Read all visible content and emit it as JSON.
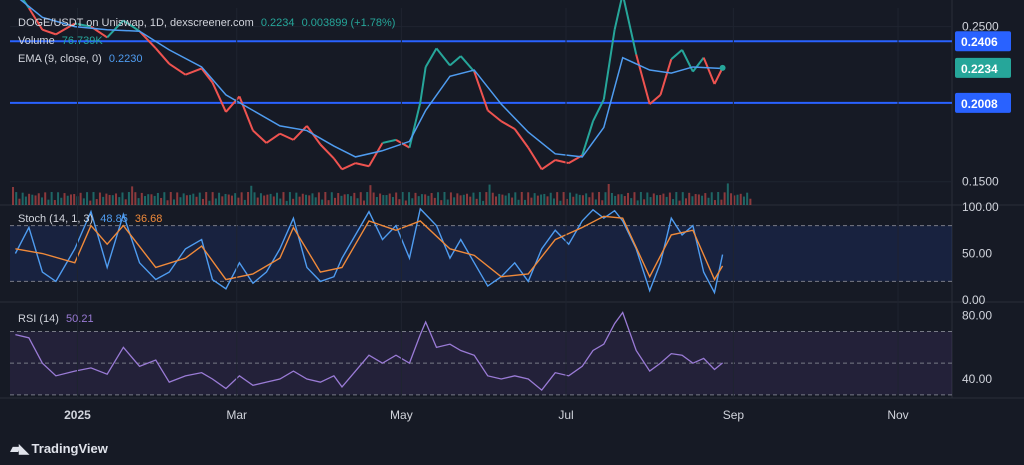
{
  "header": {
    "symbol": "DOGE/USDT on Uniswap, 1D, dexscreener.com",
    "last": "0.2234",
    "change": "0.003899 (+1.78%)",
    "volume_label": "Volume",
    "volume_value": "76.739K",
    "ema_label": "EMA (9, close, 0)",
    "ema_value": "0.2230"
  },
  "stoch": {
    "label": "Stoch (14, 1, 3)",
    "k": "48.85",
    "d": "36.68"
  },
  "rsi": {
    "label": "RSI (14)",
    "value": "50.21"
  },
  "brand": "TradingView",
  "colors": {
    "up": "#26a69a",
    "down": "#ef5350",
    "line": "#2962ff",
    "ema": "#4f9cf0",
    "stoch_k": "#4f9cf0",
    "stoch_d": "#f08a3a",
    "rsi": "#9a7bd6",
    "bg": "#161a25"
  },
  "chart_data": [
    {
      "type": "line",
      "panel": "price",
      "y_ticks": [
        "0.2500",
        "0.1500"
      ],
      "ylim": [
        0.135,
        0.262
      ],
      "horizontal_lines": [
        {
          "value": 0.2406,
          "label": "0.2406"
        },
        {
          "value": 0.2008,
          "label": "0.2008"
        }
      ],
      "last_price_label": "0.2234",
      "x_ticks": [
        "2025",
        "Mar",
        "May",
        "Jul",
        "Sep",
        "Nov"
      ],
      "xlim": [
        "2024-12-07",
        "2025-11-21"
      ],
      "close": [
        {
          "date": "2024-12-09",
          "v": 0.275
        },
        {
          "date": "2024-12-14",
          "v": 0.262
        },
        {
          "date": "2024-12-19",
          "v": 0.248
        },
        {
          "date": "2024-12-24",
          "v": 0.245
        },
        {
          "date": "2024-12-31",
          "v": 0.252
        },
        {
          "date": "2025-01-06",
          "v": 0.25
        },
        {
          "date": "2025-01-12",
          "v": 0.243
        },
        {
          "date": "2025-01-18",
          "v": 0.254
        },
        {
          "date": "2025-01-24",
          "v": 0.247
        },
        {
          "date": "2025-01-30",
          "v": 0.236
        },
        {
          "date": "2025-02-04",
          "v": 0.226
        },
        {
          "date": "2025-02-10",
          "v": 0.219
        },
        {
          "date": "2025-02-16",
          "v": 0.223
        },
        {
          "date": "2025-02-20",
          "v": 0.214
        },
        {
          "date": "2025-02-25",
          "v": 0.195
        },
        {
          "date": "2025-03-02",
          "v": 0.205
        },
        {
          "date": "2025-03-07",
          "v": 0.183
        },
        {
          "date": "2025-03-12",
          "v": 0.175
        },
        {
          "date": "2025-03-17",
          "v": 0.181
        },
        {
          "date": "2025-03-22",
          "v": 0.177
        },
        {
          "date": "2025-03-27",
          "v": 0.186
        },
        {
          "date": "2025-04-01",
          "v": 0.174
        },
        {
          "date": "2025-04-06",
          "v": 0.165
        },
        {
          "date": "2025-04-09",
          "v": 0.158
        },
        {
          "date": "2025-04-14",
          "v": 0.162
        },
        {
          "date": "2025-04-19",
          "v": 0.16
        },
        {
          "date": "2025-04-24",
          "v": 0.175
        },
        {
          "date": "2025-04-29",
          "v": 0.177
        },
        {
          "date": "2025-05-04",
          "v": 0.172
        },
        {
          "date": "2025-05-08",
          "v": 0.201
        },
        {
          "date": "2025-05-10",
          "v": 0.224
        },
        {
          "date": "2025-05-14",
          "v": 0.236
        },
        {
          "date": "2025-05-19",
          "v": 0.225
        },
        {
          "date": "2025-05-23",
          "v": 0.231
        },
        {
          "date": "2025-05-28",
          "v": 0.221
        },
        {
          "date": "2025-06-02",
          "v": 0.196
        },
        {
          "date": "2025-06-07",
          "v": 0.189
        },
        {
          "date": "2025-06-12",
          "v": 0.184
        },
        {
          "date": "2025-06-17",
          "v": 0.172
        },
        {
          "date": "2025-06-22",
          "v": 0.158
        },
        {
          "date": "2025-06-27",
          "v": 0.164
        },
        {
          "date": "2025-07-02",
          "v": 0.162
        },
        {
          "date": "2025-07-07",
          "v": 0.167
        },
        {
          "date": "2025-07-11",
          "v": 0.189
        },
        {
          "date": "2025-07-15",
          "v": 0.203
        },
        {
          "date": "2025-07-19",
          "v": 0.248
        },
        {
          "date": "2025-07-22",
          "v": 0.271
        },
        {
          "date": "2025-07-27",
          "v": 0.232
        },
        {
          "date": "2025-08-01",
          "v": 0.2
        },
        {
          "date": "2025-08-05",
          "v": 0.206
        },
        {
          "date": "2025-08-09",
          "v": 0.229
        },
        {
          "date": "2025-08-13",
          "v": 0.235
        },
        {
          "date": "2025-08-17",
          "v": 0.221
        },
        {
          "date": "2025-08-21",
          "v": 0.23
        },
        {
          "date": "2025-08-25",
          "v": 0.213
        },
        {
          "date": "2025-08-28",
          "v": 0.2234
        }
      ],
      "ema9": [
        {
          "date": "2024-12-09",
          "v": 0.27
        },
        {
          "date": "2024-12-19",
          "v": 0.256
        },
        {
          "date": "2024-12-31",
          "v": 0.25
        },
        {
          "date": "2025-01-12",
          "v": 0.248
        },
        {
          "date": "2025-01-24",
          "v": 0.247
        },
        {
          "date": "2025-02-04",
          "v": 0.235
        },
        {
          "date": "2025-02-16",
          "v": 0.224
        },
        {
          "date": "2025-02-25",
          "v": 0.206
        },
        {
          "date": "2025-03-07",
          "v": 0.196
        },
        {
          "date": "2025-03-17",
          "v": 0.186
        },
        {
          "date": "2025-03-27",
          "v": 0.183
        },
        {
          "date": "2025-04-06",
          "v": 0.173
        },
        {
          "date": "2025-04-14",
          "v": 0.166
        },
        {
          "date": "2025-04-24",
          "v": 0.17
        },
        {
          "date": "2025-05-04",
          "v": 0.176
        },
        {
          "date": "2025-05-10",
          "v": 0.196
        },
        {
          "date": "2025-05-19",
          "v": 0.218
        },
        {
          "date": "2025-05-28",
          "v": 0.222
        },
        {
          "date": "2025-06-07",
          "v": 0.2
        },
        {
          "date": "2025-06-17",
          "v": 0.182
        },
        {
          "date": "2025-06-27",
          "v": 0.168
        },
        {
          "date": "2025-07-07",
          "v": 0.166
        },
        {
          "date": "2025-07-15",
          "v": 0.185
        },
        {
          "date": "2025-07-22",
          "v": 0.23
        },
        {
          "date": "2025-08-01",
          "v": 0.222
        },
        {
          "date": "2025-08-09",
          "v": 0.22
        },
        {
          "date": "2025-08-17",
          "v": 0.224
        },
        {
          "date": "2025-08-28",
          "v": 0.223
        }
      ]
    },
    {
      "type": "line",
      "panel": "stochastic",
      "y_ticks": [
        "100.00",
        "50.00",
        "0.00"
      ],
      "ylim": [
        0,
        100
      ],
      "bands": [
        20,
        80
      ],
      "k": [
        {
          "date": "2024-12-09",
          "v": 50
        },
        {
          "date": "2024-12-14",
          "v": 78
        },
        {
          "date": "2024-12-19",
          "v": 30
        },
        {
          "date": "2024-12-24",
          "v": 20
        },
        {
          "date": "2024-12-31",
          "v": 55
        },
        {
          "date": "2025-01-06",
          "v": 95
        },
        {
          "date": "2025-01-12",
          "v": 35
        },
        {
          "date": "2025-01-18",
          "v": 92
        },
        {
          "date": "2025-01-24",
          "v": 40
        },
        {
          "date": "2025-01-30",
          "v": 22
        },
        {
          "date": "2025-02-04",
          "v": 30
        },
        {
          "date": "2025-02-10",
          "v": 55
        },
        {
          "date": "2025-02-16",
          "v": 65
        },
        {
          "date": "2025-02-20",
          "v": 22
        },
        {
          "date": "2025-02-25",
          "v": 12
        },
        {
          "date": "2025-03-02",
          "v": 40
        },
        {
          "date": "2025-03-07",
          "v": 18
        },
        {
          "date": "2025-03-12",
          "v": 30
        },
        {
          "date": "2025-03-17",
          "v": 55
        },
        {
          "date": "2025-03-22",
          "v": 88
        },
        {
          "date": "2025-03-27",
          "v": 35
        },
        {
          "date": "2025-04-01",
          "v": 20
        },
        {
          "date": "2025-04-06",
          "v": 25
        },
        {
          "date": "2025-04-09",
          "v": 45
        },
        {
          "date": "2025-04-14",
          "v": 70
        },
        {
          "date": "2025-04-19",
          "v": 95
        },
        {
          "date": "2025-04-24",
          "v": 65
        },
        {
          "date": "2025-04-29",
          "v": 80
        },
        {
          "date": "2025-05-04",
          "v": 45
        },
        {
          "date": "2025-05-08",
          "v": 98
        },
        {
          "date": "2025-05-14",
          "v": 80
        },
        {
          "date": "2025-05-19",
          "v": 45
        },
        {
          "date": "2025-05-23",
          "v": 65
        },
        {
          "date": "2025-05-28",
          "v": 40
        },
        {
          "date": "2025-06-02",
          "v": 15
        },
        {
          "date": "2025-06-07",
          "v": 25
        },
        {
          "date": "2025-06-12",
          "v": 40
        },
        {
          "date": "2025-06-17",
          "v": 20
        },
        {
          "date": "2025-06-22",
          "v": 55
        },
        {
          "date": "2025-06-27",
          "v": 75
        },
        {
          "date": "2025-07-02",
          "v": 60
        },
        {
          "date": "2025-07-07",
          "v": 85
        },
        {
          "date": "2025-07-11",
          "v": 97
        },
        {
          "date": "2025-07-15",
          "v": 88
        },
        {
          "date": "2025-07-19",
          "v": 96
        },
        {
          "date": "2025-07-22",
          "v": 85
        },
        {
          "date": "2025-07-27",
          "v": 55
        },
        {
          "date": "2025-08-01",
          "v": 10
        },
        {
          "date": "2025-08-05",
          "v": 40
        },
        {
          "date": "2025-08-09",
          "v": 88
        },
        {
          "date": "2025-08-13",
          "v": 70
        },
        {
          "date": "2025-08-17",
          "v": 80
        },
        {
          "date": "2025-08-21",
          "v": 30
        },
        {
          "date": "2025-08-25",
          "v": 8
        },
        {
          "date": "2025-08-28",
          "v": 48.85
        }
      ],
      "d": [
        {
          "date": "2024-12-09",
          "v": 55
        },
        {
          "date": "2024-12-19",
          "v": 50
        },
        {
          "date": "2024-12-31",
          "v": 40
        },
        {
          "date": "2025-01-06",
          "v": 80
        },
        {
          "date": "2025-01-12",
          "v": 60
        },
        {
          "date": "2025-01-18",
          "v": 80
        },
        {
          "date": "2025-01-30",
          "v": 35
        },
        {
          "date": "2025-02-10",
          "v": 45
        },
        {
          "date": "2025-02-16",
          "v": 58
        },
        {
          "date": "2025-02-25",
          "v": 22
        },
        {
          "date": "2025-03-07",
          "v": 28
        },
        {
          "date": "2025-03-17",
          "v": 45
        },
        {
          "date": "2025-03-22",
          "v": 78
        },
        {
          "date": "2025-04-01",
          "v": 30
        },
        {
          "date": "2025-04-09",
          "v": 35
        },
        {
          "date": "2025-04-19",
          "v": 85
        },
        {
          "date": "2025-04-29",
          "v": 75
        },
        {
          "date": "2025-05-08",
          "v": 85
        },
        {
          "date": "2025-05-19",
          "v": 55
        },
        {
          "date": "2025-05-28",
          "v": 48
        },
        {
          "date": "2025-06-07",
          "v": 25
        },
        {
          "date": "2025-06-17",
          "v": 28
        },
        {
          "date": "2025-06-27",
          "v": 65
        },
        {
          "date": "2025-07-07",
          "v": 78
        },
        {
          "date": "2025-07-15",
          "v": 90
        },
        {
          "date": "2025-07-22",
          "v": 88
        },
        {
          "date": "2025-08-01",
          "v": 25
        },
        {
          "date": "2025-08-09",
          "v": 70
        },
        {
          "date": "2025-08-17",
          "v": 75
        },
        {
          "date": "2025-08-25",
          "v": 22
        },
        {
          "date": "2025-08-28",
          "v": 36.68
        }
      ]
    },
    {
      "type": "line",
      "panel": "rsi",
      "y_ticks": [
        "80.00",
        "40.00"
      ],
      "ylim": [
        28,
        88
      ],
      "bands": [
        30,
        50,
        70
      ],
      "rsi": [
        {
          "date": "2024-12-09",
          "v": 68
        },
        {
          "date": "2024-12-14",
          "v": 66
        },
        {
          "date": "2024-12-19",
          "v": 50
        },
        {
          "date": "2024-12-24",
          "v": 42
        },
        {
          "date": "2024-12-31",
          "v": 45
        },
        {
          "date": "2025-01-06",
          "v": 47
        },
        {
          "date": "2025-01-12",
          "v": 43
        },
        {
          "date": "2025-01-18",
          "v": 60
        },
        {
          "date": "2025-01-24",
          "v": 48
        },
        {
          "date": "2025-01-30",
          "v": 52
        },
        {
          "date": "2025-02-04",
          "v": 38
        },
        {
          "date": "2025-02-10",
          "v": 42
        },
        {
          "date": "2025-02-16",
          "v": 44
        },
        {
          "date": "2025-02-20",
          "v": 40
        },
        {
          "date": "2025-02-25",
          "v": 34
        },
        {
          "date": "2025-03-02",
          "v": 42
        },
        {
          "date": "2025-03-07",
          "v": 36
        },
        {
          "date": "2025-03-12",
          "v": 38
        },
        {
          "date": "2025-03-17",
          "v": 40
        },
        {
          "date": "2025-03-22",
          "v": 45
        },
        {
          "date": "2025-03-27",
          "v": 40
        },
        {
          "date": "2025-04-01",
          "v": 38
        },
        {
          "date": "2025-04-06",
          "v": 42
        },
        {
          "date": "2025-04-09",
          "v": 35
        },
        {
          "date": "2025-04-14",
          "v": 45
        },
        {
          "date": "2025-04-19",
          "v": 55
        },
        {
          "date": "2025-04-24",
          "v": 50
        },
        {
          "date": "2025-04-29",
          "v": 55
        },
        {
          "date": "2025-05-04",
          "v": 50
        },
        {
          "date": "2025-05-08",
          "v": 68
        },
        {
          "date": "2025-05-10",
          "v": 76
        },
        {
          "date": "2025-05-14",
          "v": 60
        },
        {
          "date": "2025-05-19",
          "v": 62
        },
        {
          "date": "2025-05-23",
          "v": 58
        },
        {
          "date": "2025-05-28",
          "v": 55
        },
        {
          "date": "2025-06-02",
          "v": 42
        },
        {
          "date": "2025-06-07",
          "v": 40
        },
        {
          "date": "2025-06-12",
          "v": 42
        },
        {
          "date": "2025-06-17",
          "v": 40
        },
        {
          "date": "2025-06-22",
          "v": 33
        },
        {
          "date": "2025-06-27",
          "v": 44
        },
        {
          "date": "2025-07-02",
          "v": 42
        },
        {
          "date": "2025-07-07",
          "v": 48
        },
        {
          "date": "2025-07-11",
          "v": 58
        },
        {
          "date": "2025-07-15",
          "v": 62
        },
        {
          "date": "2025-07-19",
          "v": 75
        },
        {
          "date": "2025-07-22",
          "v": 82
        },
        {
          "date": "2025-07-27",
          "v": 58
        },
        {
          "date": "2025-08-01",
          "v": 45
        },
        {
          "date": "2025-08-05",
          "v": 50
        },
        {
          "date": "2025-08-09",
          "v": 56
        },
        {
          "date": "2025-08-13",
          "v": 55
        },
        {
          "date": "2025-08-17",
          "v": 50
        },
        {
          "date": "2025-08-21",
          "v": 53
        },
        {
          "date": "2025-08-25",
          "v": 46
        },
        {
          "date": "2025-08-28",
          "v": 50.21
        }
      ]
    }
  ]
}
